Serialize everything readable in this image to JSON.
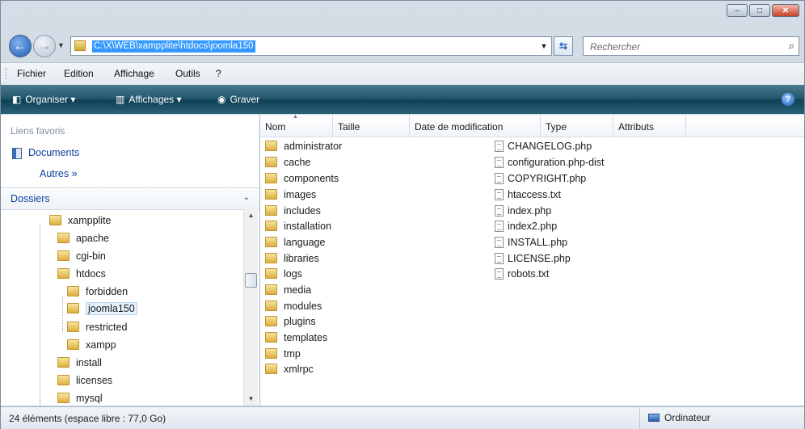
{
  "window": {
    "buttons": [
      "–",
      "□",
      "✕"
    ]
  },
  "address": {
    "path": "C:\\X\\WEB\\xampplite\\htdocs\\joomla150",
    "search_placeholder": "Rechercher"
  },
  "menu": [
    "Fichier",
    "Edition",
    "Affichage",
    "Outils",
    "?"
  ],
  "commandbar": {
    "organize": "Organiser ▾",
    "views": "Affichages ▾",
    "burn": "Graver",
    "help": "?"
  },
  "favorites": {
    "title": "Liens favoris",
    "documents": "Documents",
    "more": "Autres »"
  },
  "folders": {
    "title": "Dossiers",
    "tree": [
      {
        "label": "xampplite",
        "level": 0
      },
      {
        "label": "apache",
        "level": 1
      },
      {
        "label": "cgi-bin",
        "level": 1
      },
      {
        "label": "htdocs",
        "level": 1
      },
      {
        "label": "forbidden",
        "level": 2
      },
      {
        "label": "joomla150",
        "level": 2,
        "selected": true
      },
      {
        "label": "restricted",
        "level": 2
      },
      {
        "label": "xampp",
        "level": 2
      },
      {
        "label": "install",
        "level": 1
      },
      {
        "label": "licenses",
        "level": 1
      },
      {
        "label": "mysql",
        "level": 1
      }
    ]
  },
  "columns": [
    "Nom",
    "Taille",
    "Date de modification",
    "Type",
    "Attributs"
  ],
  "files": {
    "folders": [
      "administrator",
      "cache",
      "components",
      "images",
      "includes",
      "installation",
      "language",
      "libraries",
      "logs",
      "media",
      "modules",
      "plugins",
      "templates",
      "tmp",
      "xmlrpc"
    ],
    "documents": [
      "CHANGELOG.php",
      "configuration.php-dist",
      "COPYRIGHT.php",
      "htaccess.txt",
      "index.php",
      "index2.php",
      "INSTALL.php",
      "LICENSE.php",
      "robots.txt"
    ]
  },
  "status": {
    "left": "24 éléments (espace libre : 77,0 Go)",
    "right": "Ordinateur"
  }
}
